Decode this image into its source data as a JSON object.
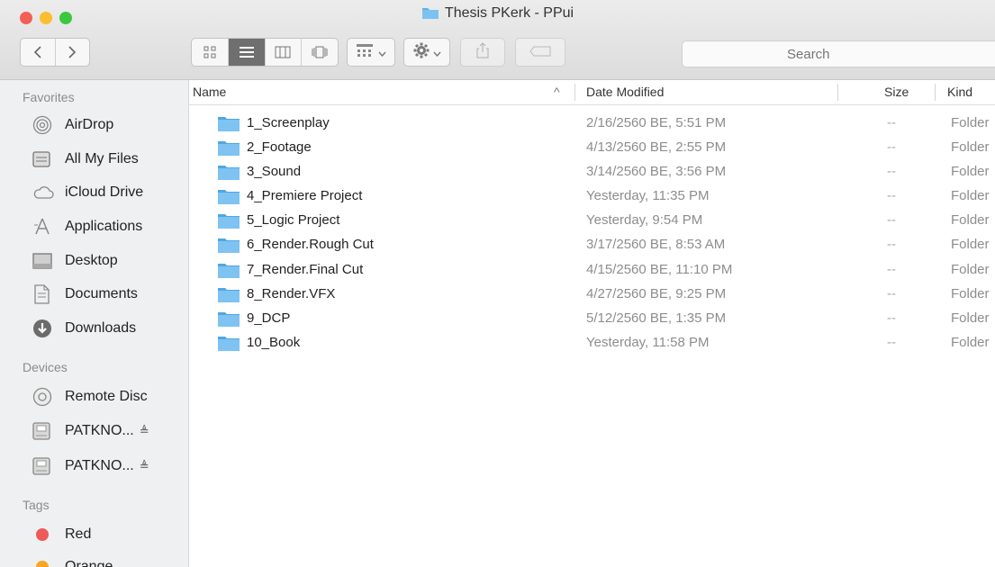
{
  "window": {
    "title": "Thesis PKerk - PPui"
  },
  "traffic_lights": {
    "close": "#f25f58",
    "minimize": "#fbbe2e",
    "zoom": "#39c840"
  },
  "toolbar": {
    "back_icon": "chevron-left-icon",
    "forward_icon": "chevron-right-icon",
    "views": [
      "icon-view-icon",
      "list-view-icon",
      "column-view-icon",
      "coverflow-view-icon"
    ],
    "selected_view": "list-view-icon",
    "arrange_icon": "arrange-grid-icon",
    "action_icon": "gear-icon",
    "share_icon": "share-icon",
    "tags_icon": "tag-icon",
    "search_placeholder": "Search"
  },
  "sidebar": {
    "favorites_label": "Favorites",
    "favorites": [
      {
        "label": "AirDrop",
        "icon": "airdrop-icon"
      },
      {
        "label": "All My Files",
        "icon": "all-files-icon"
      },
      {
        "label": "iCloud Drive",
        "icon": "cloud-icon"
      },
      {
        "label": "Applications",
        "icon": "applications-icon"
      },
      {
        "label": "Desktop",
        "icon": "desktop-icon"
      },
      {
        "label": "Documents",
        "icon": "documents-icon"
      },
      {
        "label": "Downloads",
        "icon": "downloads-icon"
      }
    ],
    "devices_label": "Devices",
    "devices": [
      {
        "label": "Remote Disc",
        "icon": "disc-icon"
      },
      {
        "label": "PATKNO...",
        "icon": "drive-icon",
        "eject": "≜"
      },
      {
        "label": "PATKNO...",
        "icon": "drive-icon",
        "eject": "≜"
      }
    ],
    "tags_label": "Tags",
    "tags": [
      {
        "label": "Red",
        "color": "#ee5a57"
      },
      {
        "label": "Orange",
        "color": "#f5a623"
      }
    ]
  },
  "list": {
    "columns": {
      "name": "Name",
      "sort_indicator": "^",
      "date": "Date Modified",
      "size": "Size",
      "kind": "Kind"
    },
    "folder_color": "#5fb0e8",
    "rows": [
      {
        "name": "1_Screenplay",
        "date": "2/16/2560 BE, 5:51 PM",
        "size": "--",
        "kind": "Folder"
      },
      {
        "name": "2_Footage",
        "date": "4/13/2560 BE, 2:55 PM",
        "size": "--",
        "kind": "Folder"
      },
      {
        "name": "3_Sound",
        "date": "3/14/2560 BE, 3:56 PM",
        "size": "--",
        "kind": "Folder"
      },
      {
        "name": "4_Premiere Project",
        "date": "Yesterday, 11:35 PM",
        "size": "--",
        "kind": "Folder"
      },
      {
        "name": "5_Logic Project",
        "date": "Yesterday, 9:54 PM",
        "size": "--",
        "kind": "Folder"
      },
      {
        "name": "6_Render.Rough Cut",
        "date": "3/17/2560 BE, 8:53 AM",
        "size": "--",
        "kind": "Folder"
      },
      {
        "name": "7_Render.Final Cut",
        "date": "4/15/2560 BE, 11:10 PM",
        "size": "--",
        "kind": "Folder"
      },
      {
        "name": "8_Render.VFX",
        "date": "4/27/2560 BE, 9:25 PM",
        "size": "--",
        "kind": "Folder"
      },
      {
        "name": "9_DCP",
        "date": "5/12/2560 BE, 1:35 PM",
        "size": "--",
        "kind": "Folder"
      },
      {
        "name": "10_Book",
        "date": "Yesterday, 11:58 PM",
        "size": "--",
        "kind": "Folder"
      }
    ]
  }
}
